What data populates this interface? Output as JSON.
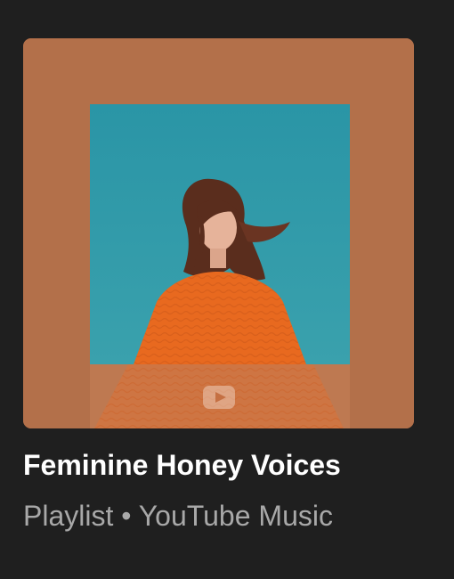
{
  "playlist": {
    "title": "Feminine Honey Voices",
    "type_label": "Playlist",
    "separator": "•",
    "source": "YouTube Music",
    "artwork_icon": "play-icon"
  },
  "colors": {
    "background": "#1f1f1f",
    "card_fill": "#b3704a",
    "photo_background": "#2f9aaa",
    "sweater": "#e8691f",
    "hair": "#5a2d1d",
    "title_text": "#ffffff",
    "subtitle_text": "#a8a8a8"
  }
}
